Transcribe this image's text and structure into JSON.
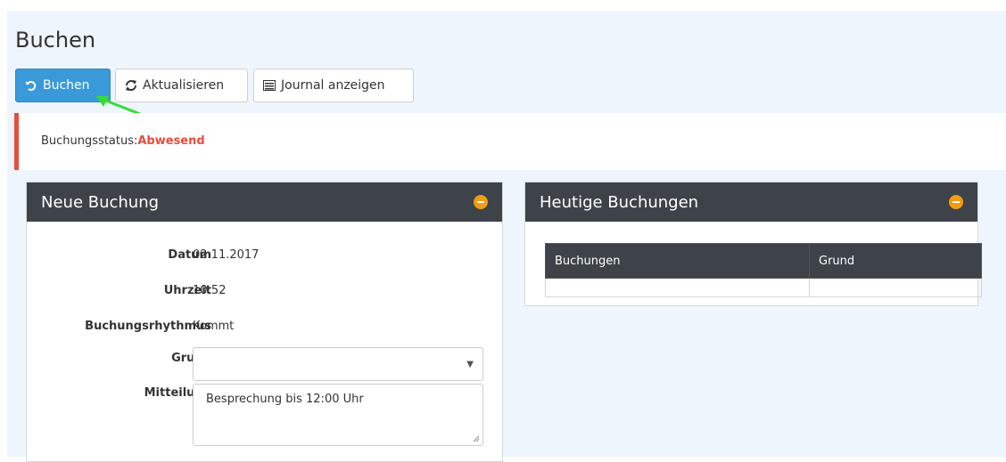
{
  "page": {
    "title": "Buchen"
  },
  "toolbar": {
    "book_label": "Buchen",
    "refresh_label": "Aktualisieren",
    "journal_label": "Journal anzeigen"
  },
  "status": {
    "label": "Buchungsstatus:",
    "value": "Abwesend"
  },
  "new_booking": {
    "title": "Neue Buchung",
    "fields": {
      "date_label": "Datum",
      "date_value": "02.11.2017",
      "time_label": "Uhrzeit",
      "time_value": "10:52",
      "rhythm_label": "Buchungsrhythmus",
      "rhythm_value": "Kommt",
      "reason_label": "Grund",
      "reason_value": "",
      "message_label": "Mitteilung",
      "message_value": "Besprechung bis 12:00 Uhr"
    }
  },
  "today_bookings": {
    "title": "Heutige Buchungen",
    "columns": [
      "Buchungen",
      "Grund"
    ],
    "rows": [
      [
        "",
        ""
      ]
    ]
  },
  "colors": {
    "primary": "#3a9ad9",
    "danger": "#e74c3c",
    "panel_header": "#3e4349",
    "collapse": "#f39c12",
    "pointer_arrow": "#33dd33"
  }
}
